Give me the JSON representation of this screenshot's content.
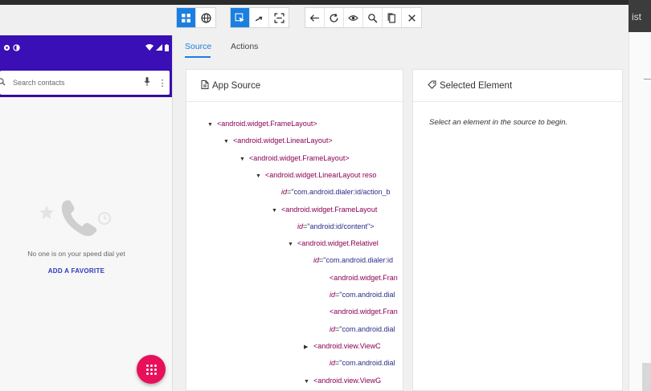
{
  "toolbar": {
    "group1": [
      "select-elements-icon",
      "web-icon"
    ],
    "group2": [
      "tap-icon",
      "swipe-icon",
      "tap-coordinates-icon"
    ],
    "group3": [
      "back-icon",
      "refresh-icon",
      "eye-icon",
      "search-icon",
      "copy-icon",
      "close-icon"
    ]
  },
  "corner_text": "ist",
  "phone": {
    "search_placeholder": "Search contacts",
    "empty_message": "No one is on your speed dial yet",
    "add_favorite": "ADD A FAVORITE",
    "accent": "#3a0fb5",
    "fab_color": "#e8105a"
  },
  "tabs": [
    {
      "label": "Source",
      "active": true
    },
    {
      "label": "Actions",
      "active": false
    }
  ],
  "source_panel": {
    "title": "App Source",
    "lines": [
      {
        "arrow": "▼",
        "indent": 0,
        "tag": "<android.widget.FrameLayout>",
        "attr": "",
        "val": ""
      },
      {
        "arrow": "▼",
        "indent": 1,
        "tag": "<android.widget.LinearLayout>",
        "attr": "",
        "val": ""
      },
      {
        "arrow": "▼",
        "indent": 2,
        "tag": "<android.widget.FrameLayout>",
        "attr": "",
        "val": ""
      },
      {
        "arrow": "▼",
        "indent": 3,
        "tag": "<android.widget.LinearLayout reso",
        "attr": "",
        "val": ""
      },
      {
        "arrow": "",
        "indent": 4,
        "tag": "",
        "attr": "id",
        "val": "\"com.android.dialer:id/action_b"
      },
      {
        "arrow": "▼",
        "indent": 4,
        "tag": "<android.widget.FrameLayout",
        "attr": "",
        "val": ""
      },
      {
        "arrow": "",
        "indent": 5,
        "tag": "",
        "attr": "id",
        "val": "\"android:id/content\">"
      },
      {
        "arrow": "▼",
        "indent": 5,
        "tag": "<android.widget.Relativel",
        "attr": "",
        "val": ""
      },
      {
        "arrow": "",
        "indent": 6,
        "tag": "",
        "attr": "id",
        "val": "\"com.android.dialer:id"
      },
      {
        "arrow": "",
        "indent": 7,
        "tag": "<android.widget.Fran",
        "attr": "",
        "val": ""
      },
      {
        "arrow": "",
        "indent": 7,
        "tag": "",
        "attr": "id",
        "val": "\"com.android.dial"
      },
      {
        "arrow": "",
        "indent": 7,
        "tag": "<android.widget.Fran",
        "attr": "",
        "val": ""
      },
      {
        "arrow": "",
        "indent": 7,
        "tag": "",
        "attr": "id",
        "val": "\"com.android.dial"
      },
      {
        "arrow": "▶",
        "indent": 6,
        "tag": "<android.view.ViewC",
        "attr": "",
        "val": ""
      },
      {
        "arrow": "",
        "indent": 7,
        "tag": "",
        "attr": "id",
        "val": "\"com.android.dial"
      },
      {
        "arrow": "▼",
        "indent": 6,
        "tag": "<android.view.ViewG",
        "attr": "",
        "val": ""
      }
    ]
  },
  "selected_panel": {
    "title": "Selected Element",
    "hint": "Select an element in the source to begin."
  }
}
